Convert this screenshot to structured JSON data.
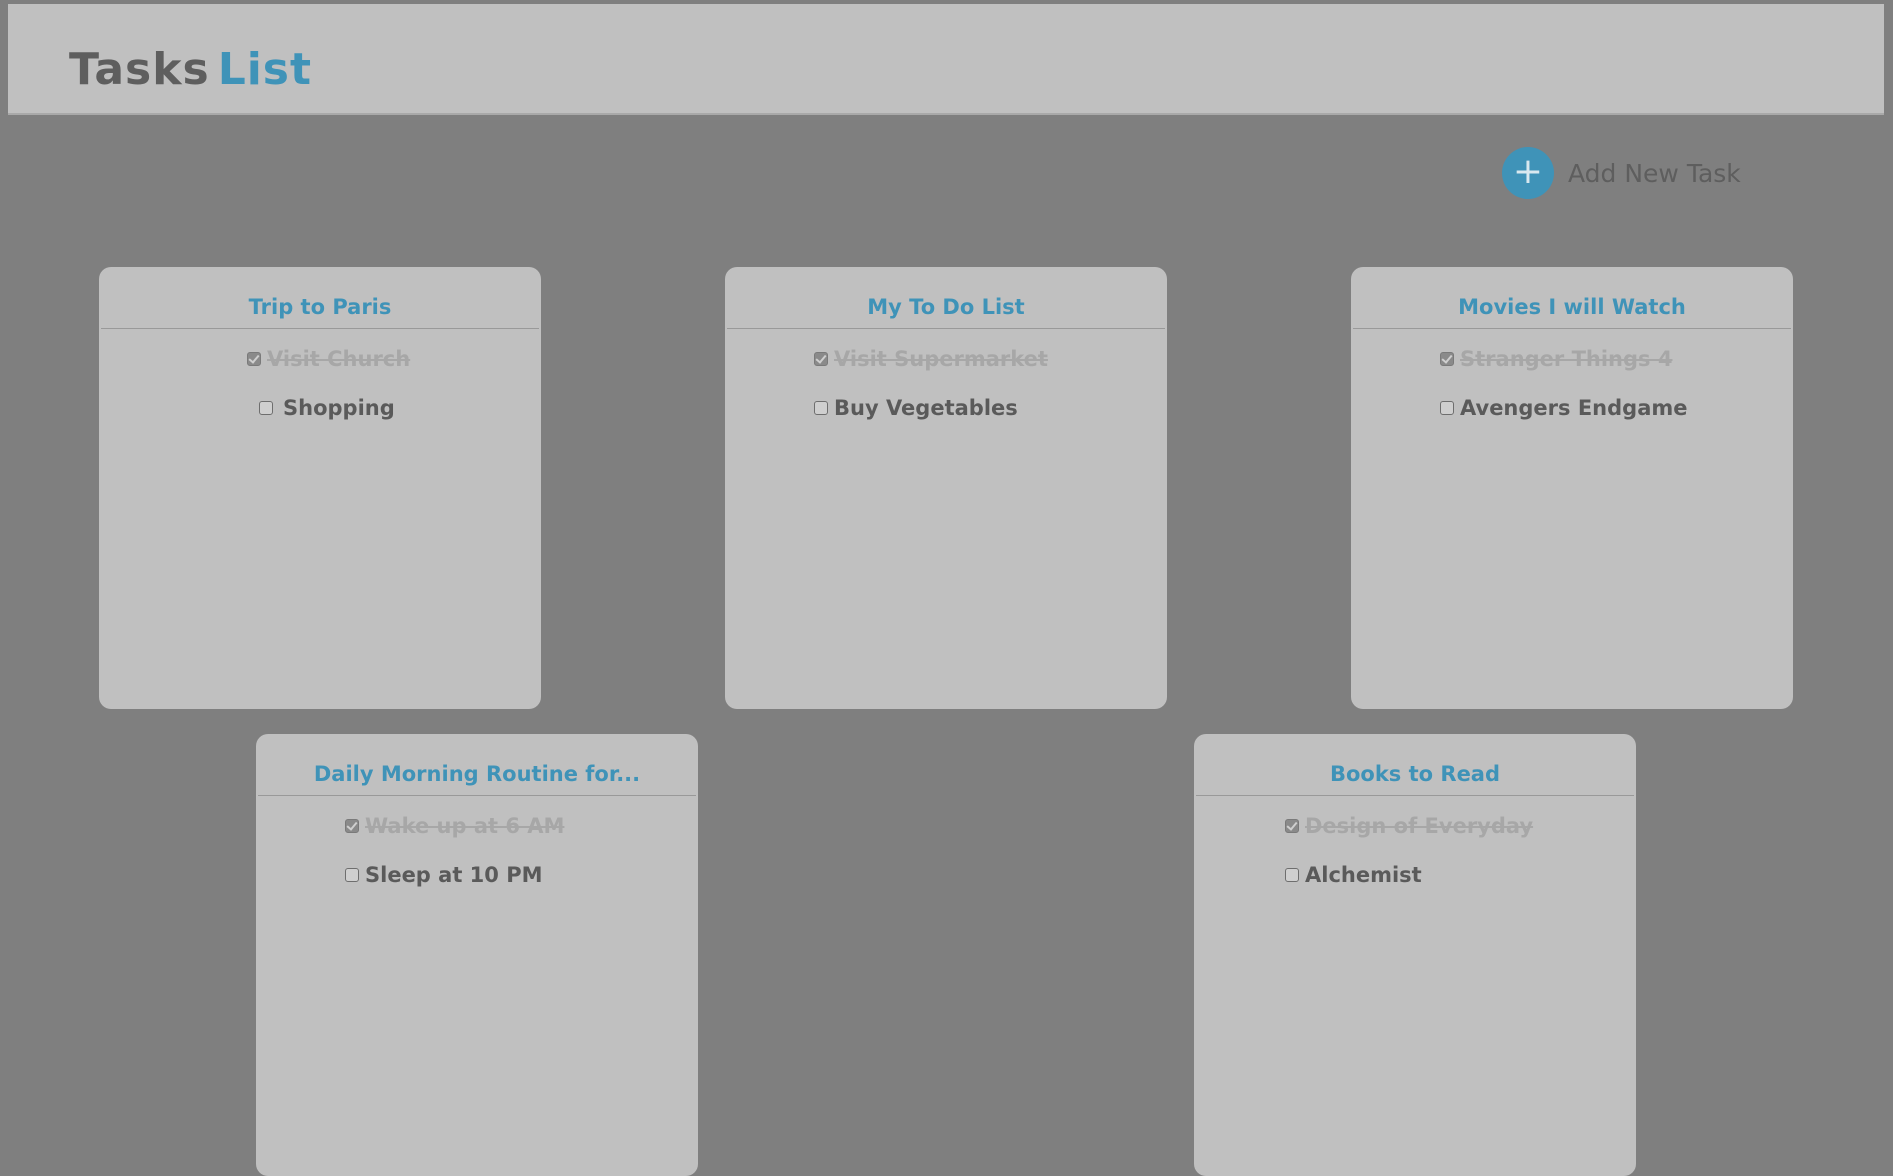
{
  "header": {
    "title_part1": "Tasks",
    "title_part2": "List"
  },
  "actions": {
    "add_label": "Add New Task",
    "add_icon": "plus-icon"
  },
  "colors": {
    "accent": "#3f93b8",
    "background": "#7f7f7f",
    "card": "#c0c0c0"
  },
  "cards": [
    {
      "title": "Trip to Paris",
      "tasks": [
        {
          "label": "Visit Church",
          "done": true
        },
        {
          "label": "Shopping",
          "done": false
        }
      ]
    },
    {
      "title": "My To Do List",
      "tasks": [
        {
          "label": "Visit Supermarket",
          "done": true
        },
        {
          "label": "Buy Vegetables",
          "done": false
        }
      ]
    },
    {
      "title": "Movies I will Watch",
      "tasks": [
        {
          "label": "Stranger Things 4",
          "done": true
        },
        {
          "label": "Avengers Endgame",
          "done": false
        }
      ]
    },
    {
      "title": "Daily Morning Routine for...",
      "tasks": [
        {
          "label": "Wake up at 6 AM",
          "done": true
        },
        {
          "label": "Sleep at 10 PM",
          "done": false
        }
      ]
    },
    {
      "title": "Books to Read",
      "tasks": [
        {
          "label": "Design of Everyday",
          "done": true
        },
        {
          "label": "Alchemist",
          "done": false
        }
      ]
    }
  ]
}
